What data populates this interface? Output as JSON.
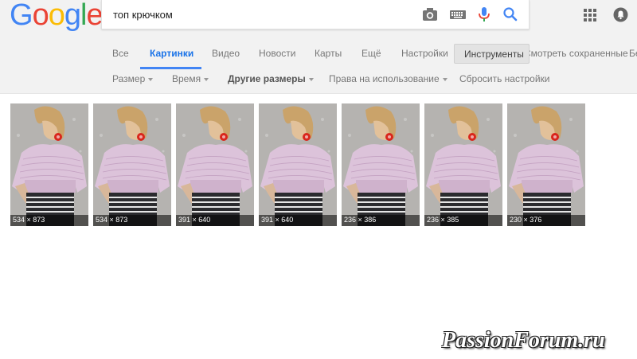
{
  "logo": {
    "letters": [
      "G",
      "o",
      "o",
      "g",
      "l",
      "e"
    ],
    "colors": [
      "#4285f4",
      "#ea4335",
      "#fbbc05",
      "#4285f4",
      "#34a853",
      "#ea4335"
    ]
  },
  "search": {
    "query": "топ крючком"
  },
  "tabs": [
    {
      "label": "Все"
    },
    {
      "label": "Картинки",
      "active": true
    },
    {
      "label": "Видео"
    },
    {
      "label": "Новости"
    },
    {
      "label": "Карты"
    },
    {
      "label": "Ещё"
    },
    {
      "label": "Настройки"
    }
  ],
  "tools_label": "Инструменты",
  "saved_label": "Смотреть сохраненные",
  "cut_label": "Бе",
  "filters": [
    {
      "label": "Размер",
      "dropdown": true
    },
    {
      "label": "Время",
      "dropdown": true
    },
    {
      "label": "Другие размеры",
      "dropdown": true,
      "bold": true
    },
    {
      "label": "Права на использование",
      "dropdown": true
    },
    {
      "label": "Сбросить настройки",
      "dropdown": false
    }
  ],
  "images": [
    {
      "dims": "534 × 873"
    },
    {
      "dims": "534 × 873"
    },
    {
      "dims": "391 × 640"
    },
    {
      "dims": "391 × 640"
    },
    {
      "dims": "236 × 386"
    },
    {
      "dims": "236 × 385"
    },
    {
      "dims": "230 × 376"
    }
  ],
  "watermark": "PassionForum.ru",
  "accent": "#4285f4"
}
